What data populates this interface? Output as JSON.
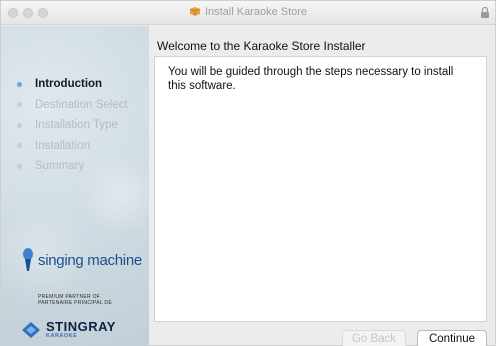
{
  "window": {
    "title": "Install Karaoke Store"
  },
  "sidebar": {
    "steps": [
      {
        "label": "Introduction",
        "active": true
      },
      {
        "label": "Destination Select",
        "active": false
      },
      {
        "label": "Installation Type",
        "active": false
      },
      {
        "label": "Installation",
        "active": false
      },
      {
        "label": "Summary",
        "active": false
      }
    ],
    "brand_logo_text": "singing machine",
    "partner_line1": "PREMIUM PARTNER OF",
    "partner_line2": "PARTENAIRE PRINCIPAL DE",
    "partner_brand": "STINGRAY",
    "partner_brand_sub": "KARAOKE"
  },
  "main": {
    "heading": "Welcome to the Karaoke Store Installer",
    "body_text": "You will be guided through the steps necessary to install this software."
  },
  "buttons": {
    "back_label": "Go Back",
    "continue_label": "Continue"
  },
  "colors": {
    "active_step_dot": "#6aa9d8",
    "brand_blue": "#1d4f8f"
  },
  "icons": {
    "title_icon": "package-icon",
    "lock": "lock-icon"
  }
}
